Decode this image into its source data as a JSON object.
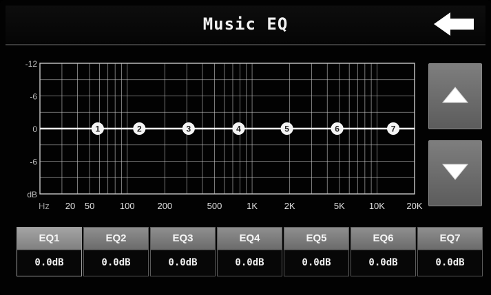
{
  "header": {
    "title": "Music EQ",
    "back_icon": "back-arrow-icon"
  },
  "graph": {
    "y_axis_labels": [
      "-12",
      "-6",
      "0",
      "-6",
      "dB"
    ],
    "x_axis_labels": [
      "Hz",
      "20",
      "50",
      "100",
      "200",
      "500",
      "1K",
      "2K",
      "5K",
      "10K",
      "20K"
    ],
    "curve_level_db": 0,
    "y_range_db": [
      -12,
      12
    ],
    "x_range_hz": [
      20,
      20000
    ],
    "band_points": [
      {
        "label": "1",
        "gain_db": 0
      },
      {
        "label": "2",
        "gain_db": 0
      },
      {
        "label": "3",
        "gain_db": 0
      },
      {
        "label": "4",
        "gain_db": 0
      },
      {
        "label": "5",
        "gain_db": 0
      },
      {
        "label": "6",
        "gain_db": 0
      },
      {
        "label": "7",
        "gain_db": 0
      }
    ]
  },
  "controls": {
    "up_icon": "triangle-up-icon",
    "down_icon": "triangle-down-icon"
  },
  "bands": [
    {
      "name": "EQ1",
      "value": "0.0dB",
      "selected": true
    },
    {
      "name": "EQ2",
      "value": "0.0dB",
      "selected": false
    },
    {
      "name": "EQ3",
      "value": "0.0dB",
      "selected": false
    },
    {
      "name": "EQ4",
      "value": "0.0dB",
      "selected": false
    },
    {
      "name": "EQ5",
      "value": "0.0dB",
      "selected": false
    },
    {
      "name": "EQ6",
      "value": "0.0dB",
      "selected": false
    },
    {
      "name": "EQ7",
      "value": "0.0dB",
      "selected": false
    }
  ],
  "colors": {
    "background": "#020202",
    "grid": "#c8c8c8",
    "curve": "#ffffff",
    "button_face": "#7a7a7a"
  }
}
